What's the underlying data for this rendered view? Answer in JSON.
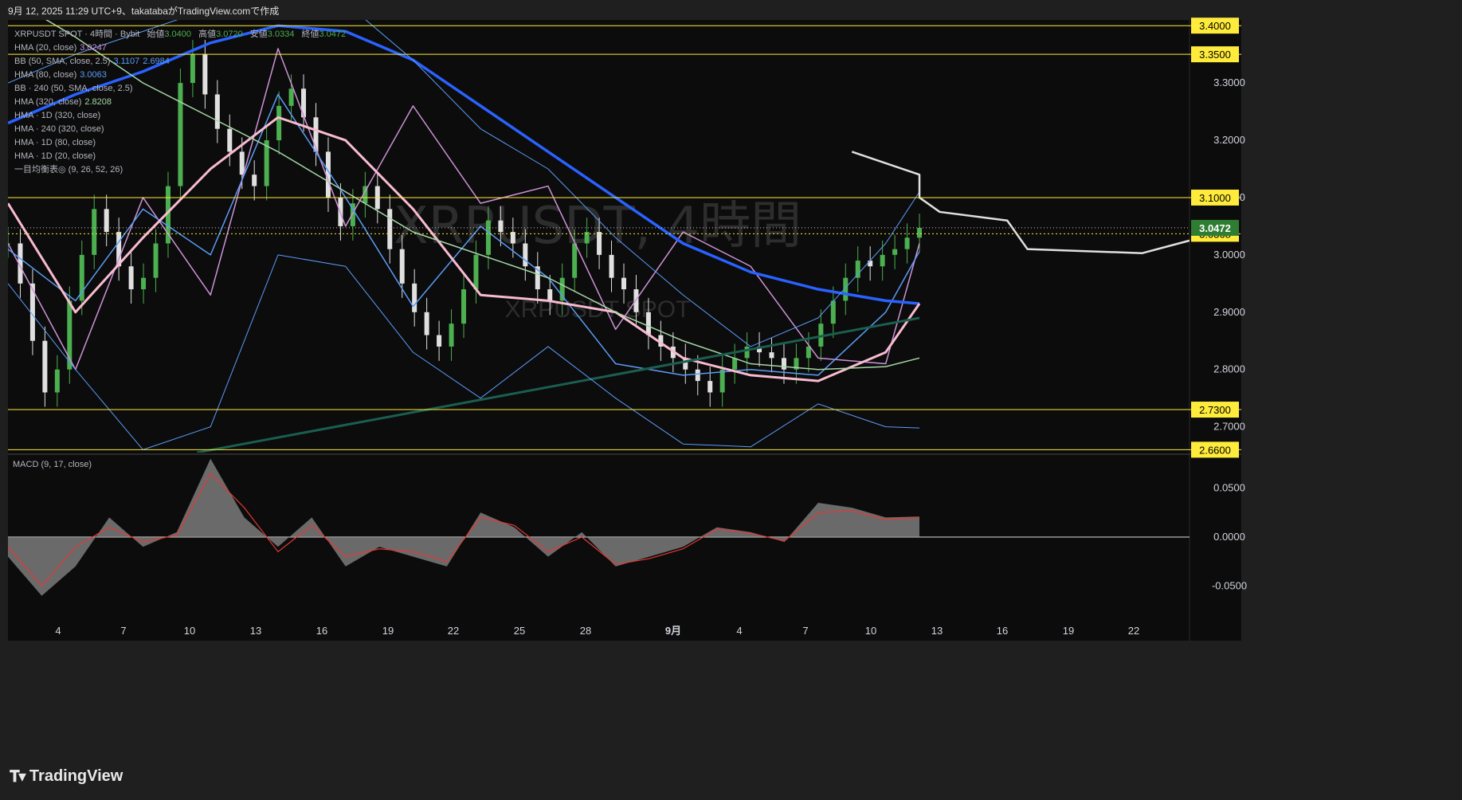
{
  "header": {
    "caption": "9月 12, 2025 11:29 UTC+9、takatabaがTradingView.comで作成",
    "symbol_line": "XRPUSDT SPOT · 4時間 · Bybit",
    "ohlc": [
      {
        "label": "始値",
        "value": "3.0400"
      },
      {
        "label": "高値",
        "value": "3.0720"
      },
      {
        "label": "安値",
        "value": "3.0334"
      },
      {
        "label": "終値",
        "value": "3.0472"
      }
    ]
  },
  "legend": [
    {
      "text": "HMA (20, close)",
      "values": [
        "3.0247"
      ],
      "colors": [
        "#ce93d8"
      ]
    },
    {
      "text": "BB (50, SMA, close, 2.5)",
      "values": [
        "3.1107",
        "2.6984"
      ],
      "colors": [
        "#5b9cf6",
        "#5b9cf6"
      ]
    },
    {
      "text": "HMA (80, close)",
      "values": [
        "3.0063"
      ],
      "colors": [
        "#5b9cf6"
      ]
    },
    {
      "text": "BB · 240 (50, SMA, close, 2.5)",
      "values": [],
      "colors": []
    },
    {
      "text": "HMA (320, close)",
      "values": [
        "2.8208"
      ],
      "colors": [
        "#a5d6a7"
      ]
    },
    {
      "text": "HMA · 1D (320, close)",
      "values": [],
      "colors": []
    },
    {
      "text": "HMA · 240 (320, close)",
      "values": [],
      "colors": []
    },
    {
      "text": "HMA · 1D (80, close)",
      "values": [],
      "colors": []
    },
    {
      "text": "HMA · 1D (20, close)",
      "values": [],
      "colors": []
    },
    {
      "text": "一目均衡表◎ (9, 26, 52, 26)",
      "values": [],
      "colors": []
    }
  ],
  "watermark": {
    "title": "XRPUSDT, 4時間",
    "subtitle": "XRPUSDT SPOT"
  },
  "macd_label": "MACD (9, 17, close)",
  "footer_brand": "TradingView",
  "colors": {
    "background": "#0c0c0c",
    "bull": "#4caf50",
    "bear": "#e0e0e0",
    "hma20": "#ce93d8",
    "bb": "#5b9cf6",
    "hma80_blue": "#2962ff",
    "pink": "#f8bbd0",
    "green_line": "#1b5e50",
    "lightgreen": "#a5d6a7",
    "projection": "#e0e0e0",
    "hline": "#ffeb3b",
    "current_price": "#2e7d32"
  },
  "chart_data": [
    {
      "type": "line",
      "title": "XRPUSDT, 4時間",
      "price_axis_ticks": [
        "3.3000",
        "3.2000",
        "3.1000",
        "3.0000",
        "2.9000",
        "2.8000",
        "2.7000"
      ],
      "time_axis_ticks": [
        "4",
        "7",
        "10",
        "13",
        "16",
        "19",
        "22",
        "25",
        "28",
        "9月",
        "4",
        "7",
        "10",
        "13",
        "16",
        "19",
        "22"
      ],
      "ylim": [
        2.655,
        3.41
      ],
      "horizontal_levels": [
        3.4,
        3.35,
        3.1,
        3.0368,
        2.73,
        2.66
      ],
      "level_labels": [
        "3.4000",
        "3.3500",
        "3.1000",
        "3.0368",
        "2.7300",
        "2.6600"
      ],
      "current_price": 3.0472,
      "current_price_label": "3.0472",
      "series": [
        {
          "name": "HMA (20, close)",
          "color": "#ce93d8",
          "x": [
            0,
            10,
            20,
            30,
            40,
            50,
            60,
            70,
            80,
            90,
            100,
            110,
            120,
            130,
            135
          ],
          "y": [
            3.02,
            2.8,
            3.1,
            2.93,
            3.36,
            3.05,
            3.26,
            3.09,
            3.12,
            2.87,
            3.04,
            2.98,
            2.82,
            2.81,
            3.02
          ]
        },
        {
          "name": "HMA (80, close)",
          "color": "#5b9cf6",
          "x": [
            0,
            10,
            20,
            30,
            40,
            50,
            60,
            70,
            80,
            90,
            100,
            110,
            120,
            130,
            135
          ],
          "y": [
            3.01,
            2.92,
            3.08,
            3.0,
            3.28,
            3.1,
            2.91,
            3.05,
            2.96,
            2.81,
            2.79,
            2.8,
            2.79,
            2.9,
            3.006
          ]
        },
        {
          "name": "HMA · 1D (80, close)",
          "color": "#2962ff",
          "x": [
            0,
            10,
            20,
            30,
            40,
            50,
            60,
            70,
            80,
            90,
            100,
            110,
            120,
            130,
            135
          ],
          "y": [
            3.23,
            3.28,
            3.32,
            3.37,
            3.4,
            3.39,
            3.34,
            3.26,
            3.18,
            3.1,
            3.02,
            2.97,
            2.94,
            2.92,
            2.915
          ]
        },
        {
          "name": "HMA (320, close)",
          "color": "#f8bbd0",
          "x": [
            0,
            10,
            20,
            30,
            40,
            50,
            60,
            70,
            80,
            90,
            100,
            110,
            120,
            130,
            135
          ],
          "y": [
            3.09,
            2.9,
            3.03,
            3.15,
            3.24,
            3.2,
            3.08,
            2.93,
            2.92,
            2.9,
            2.82,
            2.79,
            2.78,
            2.83,
            2.915
          ]
        },
        {
          "name": "HMA · 240 (320, close)",
          "color": "#a5d6a7",
          "x": [
            0,
            10,
            20,
            30,
            40,
            50,
            60,
            70,
            80,
            90,
            100,
            110,
            120,
            130,
            135
          ],
          "y": [
            3.45,
            3.38,
            3.3,
            3.24,
            3.18,
            3.11,
            3.04,
            3.0,
            2.96,
            2.9,
            2.85,
            2.81,
            2.8,
            2.805,
            2.82
          ]
        },
        {
          "name": "HMA · 1D (320, close)",
          "color": "#1b5e50",
          "x": [
            28,
            135
          ],
          "y": [
            2.655,
            2.89
          ]
        },
        {
          "name": "BB (50, SMA, close, 2.5) upper",
          "color": "#5b9cf6",
          "x": [
            0,
            10,
            20,
            30,
            40,
            50,
            60,
            70,
            80,
            90,
            100,
            110,
            120,
            130,
            135
          ],
          "y": [
            3.3,
            3.35,
            3.39,
            3.43,
            3.47,
            3.44,
            3.34,
            3.22,
            3.15,
            3.03,
            2.93,
            2.84,
            2.89,
            3.02,
            3.11
          ]
        },
        {
          "name": "BB (50, SMA, close, 2.5) lower",
          "color": "#5b9cf6",
          "x": [
            0,
            10,
            20,
            30,
            40,
            50,
            60,
            70,
            80,
            90,
            100,
            110,
            120,
            130,
            135
          ],
          "y": [
            2.95,
            2.8,
            2.66,
            2.7,
            3.0,
            2.98,
            2.83,
            2.75,
            2.84,
            2.75,
            2.67,
            2.665,
            2.74,
            2.7,
            2.698
          ]
        },
        {
          "name": "Projection",
          "color": "#e0e0e0",
          "x": [
            125,
            135,
            135,
            138,
            148,
            151,
            168,
            175
          ],
          "y": [
            3.18,
            3.14,
            3.1,
            3.075,
            3.06,
            3.01,
            3.003,
            3.025
          ]
        }
      ],
      "candles_close": [
        3.02,
        2.95,
        2.85,
        2.76,
        2.8,
        2.92,
        3.0,
        3.08,
        3.04,
        2.98,
        2.94,
        2.96,
        3.02,
        3.12,
        3.3,
        3.35,
        3.28,
        3.22,
        3.18,
        3.14,
        3.12,
        3.2,
        3.26,
        3.29,
        3.24,
        3.18,
        3.1,
        3.05,
        3.09,
        3.12,
        3.08,
        3.01,
        2.95,
        2.9,
        2.86,
        2.84,
        2.88,
        2.94,
        3.0,
        3.06,
        3.04,
        3.02,
        2.98,
        2.94,
        2.92,
        2.96,
        3.02,
        3.04,
        3.0,
        2.96,
        2.94,
        2.9,
        2.86,
        2.84,
        2.82,
        2.8,
        2.78,
        2.76,
        2.8,
        2.82,
        2.84,
        2.83,
        2.82,
        2.8,
        2.82,
        2.84,
        2.88,
        2.92,
        2.96,
        2.99,
        2.98,
        3.0,
        3.01,
        3.03,
        3.047
      ]
    },
    {
      "type": "area",
      "title": "MACD (9, 17, close)",
      "price_axis_ticks": [
        "0.0500",
        "0.0000",
        "-0.0500"
      ],
      "ylim": [
        -0.083,
        0.083
      ],
      "series": [
        {
          "name": "MACD",
          "color": "#9e9e9e",
          "x": [
            0,
            5,
            10,
            15,
            20,
            25,
            30,
            35,
            40,
            45,
            50,
            55,
            60,
            65,
            70,
            75,
            80,
            85,
            90,
            95,
            100,
            105,
            110,
            115,
            120,
            125,
            130,
            135
          ],
          "y": [
            -0.02,
            -0.06,
            -0.03,
            0.02,
            -0.01,
            0.005,
            0.08,
            0.02,
            -0.01,
            0.02,
            -0.03,
            -0.01,
            -0.02,
            -0.03,
            0.025,
            0.01,
            -0.02,
            0.005,
            -0.03,
            -0.02,
            -0.01,
            0.01,
            0.005,
            -0.005,
            0.035,
            0.03,
            0.02,
            0.021
          ]
        },
        {
          "name": "Signal",
          "color": "#e53935",
          "x": [
            0,
            5,
            10,
            15,
            20,
            25,
            30,
            35,
            40,
            45,
            50,
            55,
            60,
            65,
            70,
            75,
            80,
            85,
            90,
            95,
            100,
            105,
            110,
            115,
            120,
            125,
            130,
            135
          ],
          "y": [
            -0.01,
            -0.05,
            -0.01,
            0.01,
            -0.005,
            0.002,
            0.065,
            0.03,
            -0.015,
            0.012,
            -0.02,
            -0.012,
            -0.015,
            -0.025,
            0.02,
            0.012,
            -0.015,
            0.0,
            -0.028,
            -0.022,
            -0.012,
            0.008,
            0.004,
            -0.004,
            0.025,
            0.027,
            0.018,
            0.02
          ]
        }
      ]
    }
  ]
}
